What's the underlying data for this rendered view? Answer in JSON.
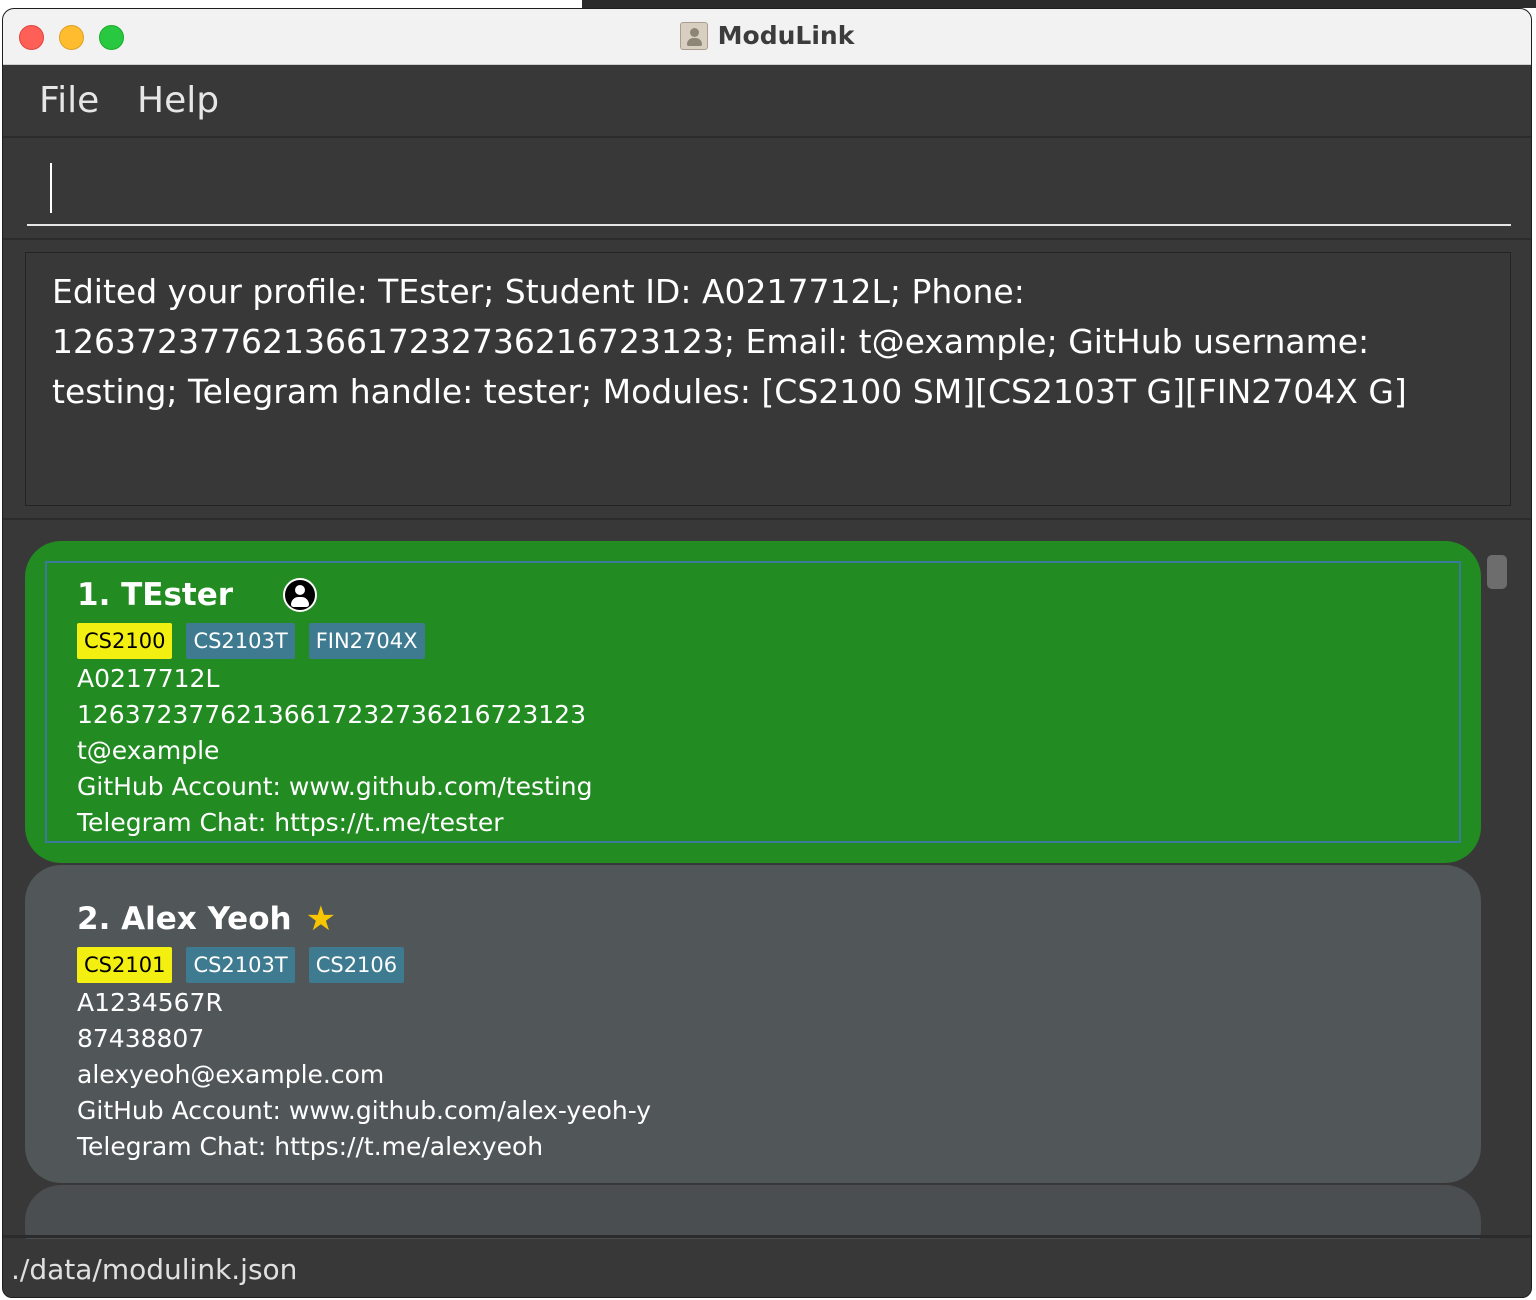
{
  "window": {
    "title": "ModuLink"
  },
  "menu": {
    "file": "File",
    "help": "Help"
  },
  "command": {
    "value": "",
    "placeholder": ""
  },
  "result": {
    "text": "Edited your profile: TEster; Student ID: A0217712L; Phone: 126372377621366172327362167231​23; Email: t@example; GitHub username: testing; Telegram handle: tester; Modules: [CS2100 SM][CS2103T G][FIN2704X G]"
  },
  "persons": [
    {
      "name": "1. TEster",
      "icon": "profile-icon",
      "tags": [
        "CS2100",
        "CS2103T",
        "FIN2704X"
      ],
      "student_id": "A0217712L",
      "phone": "126372377621366172327362167231​23",
      "email": "t@example",
      "github": "GitHub Account: www.github.com/testing",
      "telegram": "Telegram Chat: https://t.me/tester"
    },
    {
      "name": "2. Alex Yeoh",
      "icon": "star-icon",
      "tags": [
        "CS2101",
        "CS2103T",
        "CS2106"
      ],
      "student_id": "A1234567R",
      "phone": "87438807",
      "email": "alexyeoh@example.com",
      "github": "GitHub Account: www.github.com/alex-yeoh-y",
      "telegram": "Telegram Chat: https://t.me/alexyeoh"
    }
  ],
  "status": {
    "path": "./data/modulink.json"
  },
  "colors": {
    "background": "#383838",
    "selected_card": "#228b22",
    "card": "#515658",
    "primary_tag": "#f2ef11",
    "tag": "#3e7b91"
  }
}
